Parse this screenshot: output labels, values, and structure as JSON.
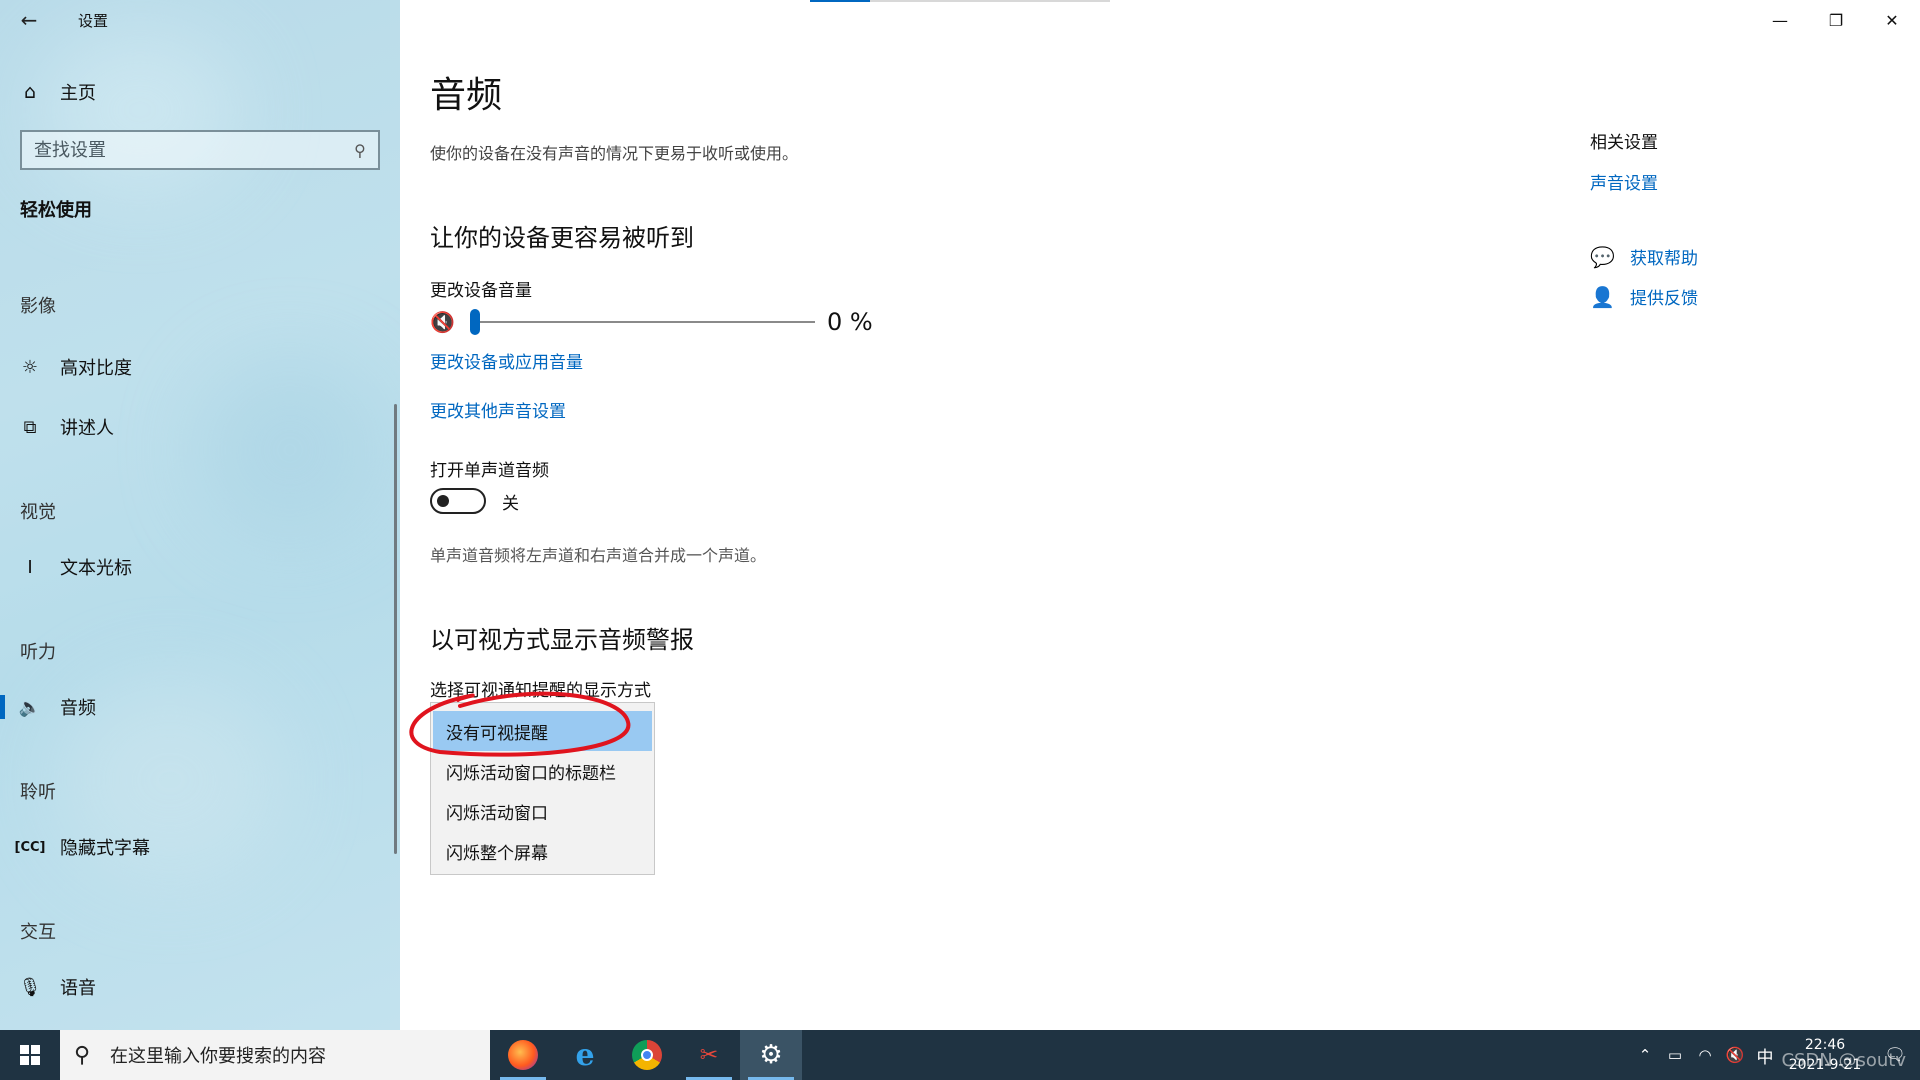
{
  "window": {
    "title": "设置",
    "controls": {
      "minimize": "—",
      "restore": "❐",
      "close": "✕"
    }
  },
  "sidebar": {
    "home_label": "主页",
    "search_placeholder": "查找设置",
    "section_title": "轻松使用",
    "groups": [
      {
        "header": "影像",
        "items": [
          {
            "label": "高对比度",
            "icon": "sun-icon"
          },
          {
            "label": "讲述人",
            "icon": "narrator-icon"
          }
        ]
      },
      {
        "header": "视觉",
        "items": [
          {
            "label": "文本光标",
            "icon": "text-cursor-icon"
          }
        ]
      },
      {
        "header": "听力",
        "items": [
          {
            "label": "音频",
            "icon": "speaker-icon",
            "selected": true
          }
        ]
      },
      {
        "header": "聆听",
        "items": [
          {
            "label": "隐藏式字幕",
            "icon": "cc-icon"
          }
        ]
      },
      {
        "header": "交互",
        "items": [
          {
            "label": "语音",
            "icon": "microphone-icon"
          }
        ]
      }
    ]
  },
  "main": {
    "title": "音频",
    "description": "使你的设备在没有声音的情况下更易于收听或使用。",
    "section1": {
      "heading": "让你的设备更容易被听到",
      "volume_label": "更改设备音量",
      "volume_value": "0 %",
      "volume_fraction": 0,
      "link1": "更改设备或应用音量",
      "link2": "更改其他声音设置"
    },
    "mono": {
      "label": "打开单声道音频",
      "state": "关",
      "on": false,
      "hint": "单声道音频将左声道和右声道合并成一个声道。"
    },
    "section2": {
      "heading": "以可视方式显示音频警报",
      "select_label": "选择可视通知提醒的显示方式",
      "options": [
        "没有可视提醒",
        "闪烁活动窗口的标题栏",
        "闪烁活动窗口",
        "闪烁整个屏幕"
      ],
      "selected_index": 0
    },
    "related": {
      "title": "相关设置",
      "link": "声音设置",
      "help": "获取帮助",
      "feedback": "提供反馈"
    }
  },
  "taskbar": {
    "search_placeholder": "在这里输入你要搜索的内容",
    "apps": [
      "firefox",
      "internet-explorer",
      "chrome",
      "app",
      "settings"
    ],
    "tray": {
      "ime": "中",
      "time": "22:46",
      "date": "2021-9-21"
    },
    "watermark": "CSDN @soutv"
  },
  "colors": {
    "accent": "#0067c0",
    "sidebar_bg": "#bfe0ec",
    "taskbar_bg": "#1f3342",
    "selected_option": "#99c9f2",
    "annotation": "#e0141e"
  }
}
